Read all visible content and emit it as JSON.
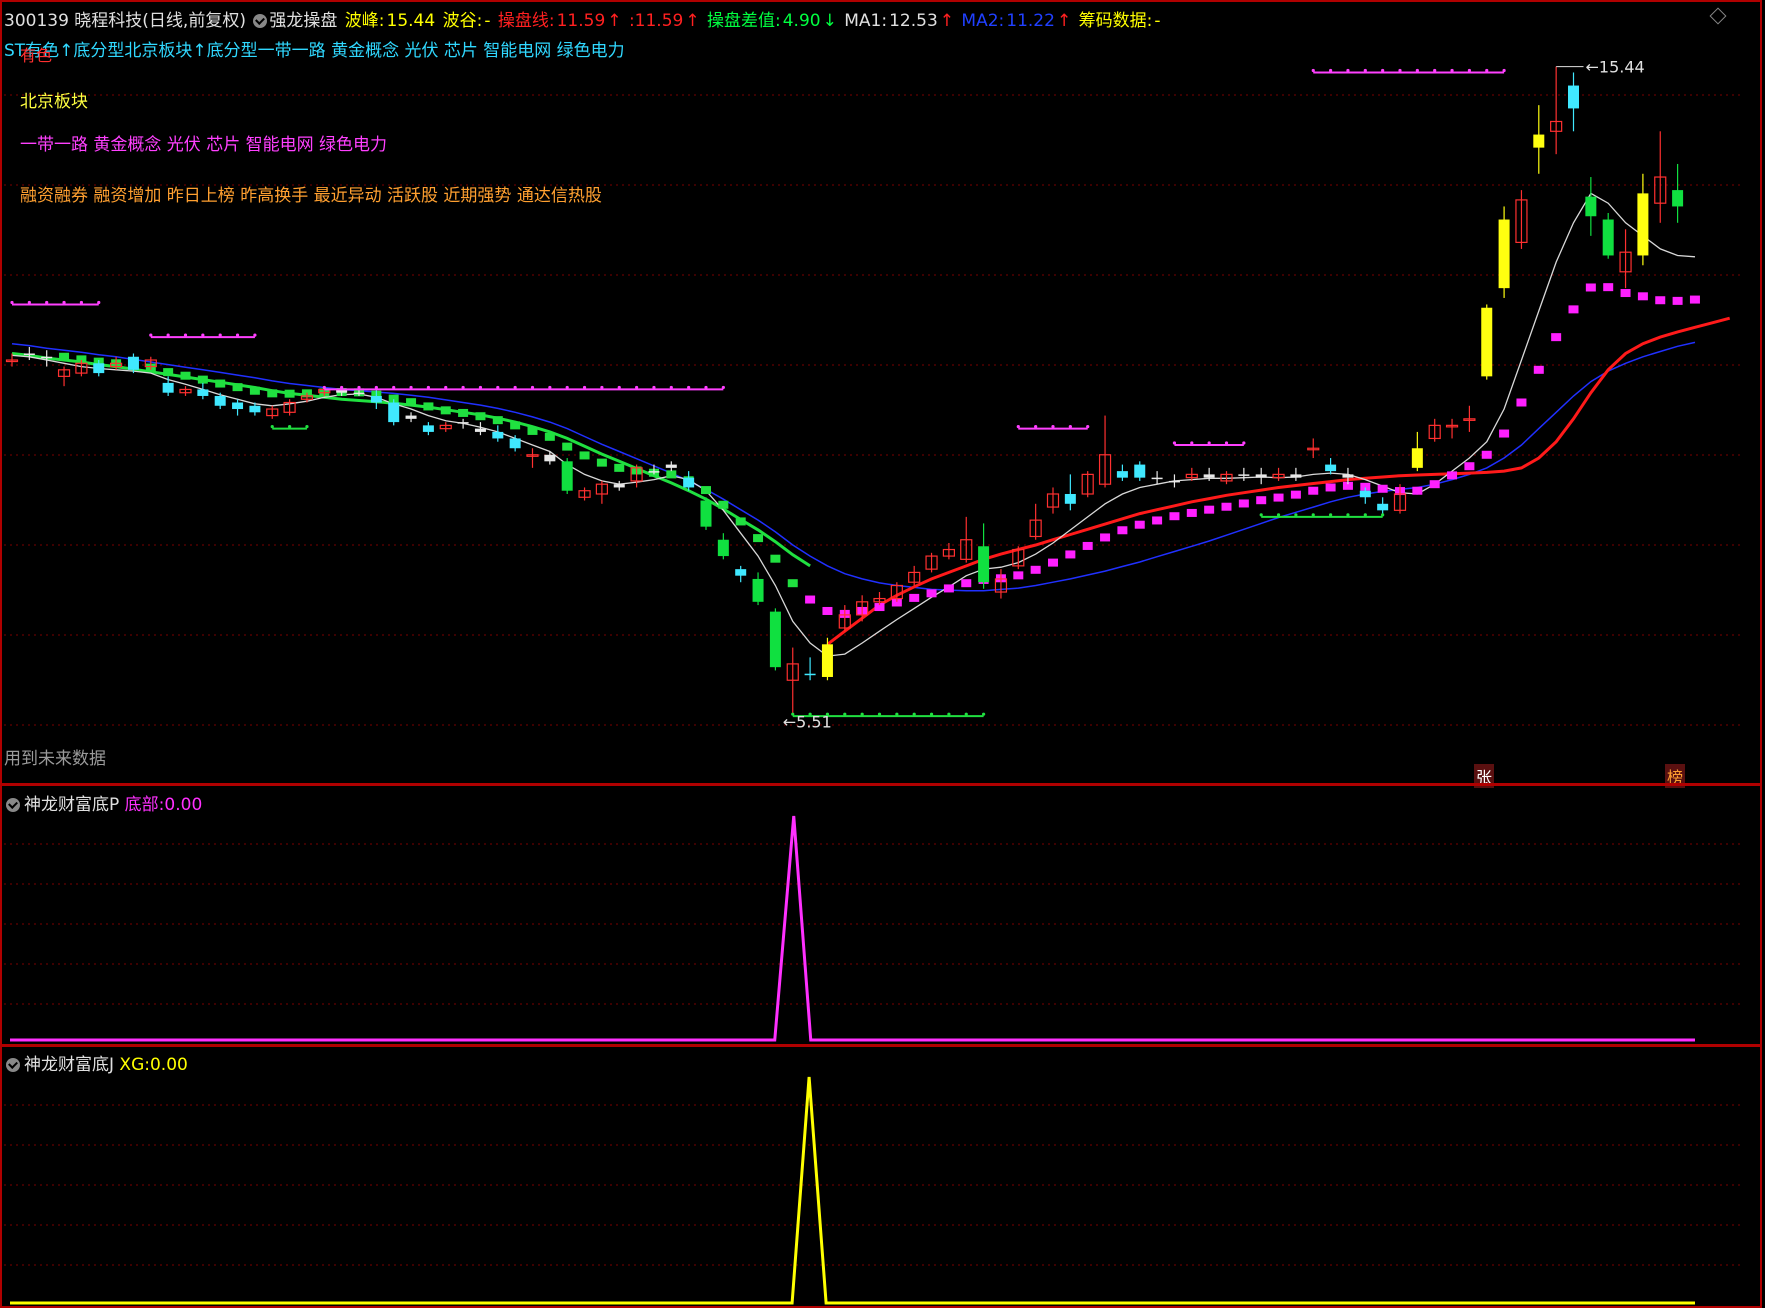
{
  "header": {
    "symbol_title": "300139 晓程科技(日线,前复权)",
    "indicator_name": "强龙操盘",
    "peak_label": "波峰:",
    "peak_value": "15.44",
    "trough_label": "波谷:",
    "trough_value": "-",
    "line_label": "操盘线:",
    "line_value": "11.59",
    "line_value2": ":11.59",
    "diff_label": "操盘差值:",
    "diff_value": "4.90",
    "ma1_label": "MA1:",
    "ma1_value": "12.53",
    "ma2_label": "MA2:",
    "ma2_value": "11.22",
    "chip_label": "筹码数据:",
    "chip_value": "-",
    "colors": {
      "peak": "#ffff00",
      "line": "#ff2020",
      "diff": "#00ff40",
      "ma1": "#e0e0e0",
      "ma2": "#2040ff",
      "chip": "#ffff00"
    }
  },
  "concepts": {
    "line1": "ST有色↑底分型北京板块↑底分型一带一路 黄金概念 光伏 芯片 智能电网 绿色电力",
    "line1_overlay": "有色",
    "line2": "北京板块",
    "line3": "一带一路 黄金概念 光伏 芯片 智能电网 绿色电力",
    "line4": "融资融券 融资增加 昨日上榜 昨高换手 最近异动 活跃股 近期强势 通达信热股"
  },
  "footer_note": "用到未来数据",
  "markers": {
    "zhang": "张",
    "bang": "榜",
    "high_label": "15.44",
    "low_label": "5.51"
  },
  "panel2": {
    "name": "神龙财富底P",
    "field_label": "底部:",
    "field_value": "0.00",
    "color": "#ff30ff"
  },
  "panel3": {
    "name": "神龙财富底J",
    "field_label": "XG:",
    "field_value": "0.00",
    "color": "#ffff00"
  },
  "chart_data": [
    {
      "type": "candlestick",
      "title": "300139 晓程科技(日线,前复权)",
      "ylim": [
        4.6,
        16.0
      ],
      "candles": [
        {
          "o": 10.95,
          "c": 10.95,
          "h": 11.05,
          "l": 10.85,
          "col": "red"
        },
        {
          "o": 11.05,
          "c": 11.05,
          "h": 11.15,
          "l": 10.95,
          "col": "white"
        },
        {
          "o": 11.0,
          "c": 11.0,
          "h": 11.1,
          "l": 10.85,
          "col": "white"
        },
        {
          "o": 10.7,
          "c": 10.8,
          "h": 10.85,
          "l": 10.55,
          "col": "red"
        },
        {
          "o": 10.75,
          "c": 10.9,
          "h": 10.95,
          "l": 10.7,
          "col": "red"
        },
        {
          "o": 10.9,
          "c": 10.75,
          "h": 10.95,
          "l": 10.7,
          "col": "cyan"
        },
        {
          "o": 10.85,
          "c": 10.9,
          "h": 11.0,
          "l": 10.8,
          "col": "red"
        },
        {
          "o": 11.0,
          "c": 10.8,
          "h": 11.05,
          "l": 10.75,
          "col": "cyan"
        },
        {
          "o": 10.85,
          "c": 10.95,
          "h": 11.0,
          "l": 10.8,
          "col": "red"
        },
        {
          "o": 10.6,
          "c": 10.45,
          "h": 10.7,
          "l": 10.4,
          "col": "cyan"
        },
        {
          "o": 10.45,
          "c": 10.5,
          "h": 10.55,
          "l": 10.4,
          "col": "red"
        },
        {
          "o": 10.5,
          "c": 10.4,
          "h": 10.6,
          "l": 10.35,
          "col": "cyan"
        },
        {
          "o": 10.4,
          "c": 10.25,
          "h": 10.45,
          "l": 10.2,
          "col": "cyan"
        },
        {
          "o": 10.3,
          "c": 10.2,
          "h": 10.35,
          "l": 10.1,
          "col": "cyan"
        },
        {
          "o": 10.25,
          "c": 10.15,
          "h": 10.3,
          "l": 10.1,
          "col": "cyan"
        },
        {
          "o": 10.1,
          "c": 10.2,
          "h": 10.25,
          "l": 10.05,
          "col": "red"
        },
        {
          "o": 10.15,
          "c": 10.3,
          "h": 10.35,
          "l": 10.1,
          "col": "red"
        },
        {
          "o": 10.35,
          "c": 10.4,
          "h": 10.45,
          "l": 10.3,
          "col": "red"
        },
        {
          "o": 10.45,
          "c": 10.5,
          "h": 10.55,
          "l": 10.4,
          "col": "red"
        },
        {
          "o": 10.5,
          "c": 10.45,
          "h": 10.55,
          "l": 10.4,
          "col": "white"
        },
        {
          "o": 10.45,
          "c": 10.45,
          "h": 10.5,
          "l": 10.4,
          "col": "white"
        },
        {
          "o": 10.4,
          "c": 10.3,
          "h": 10.5,
          "l": 10.2,
          "col": "cyan"
        },
        {
          "o": 10.3,
          "c": 10.0,
          "h": 10.35,
          "l": 9.95,
          "col": "cyan"
        },
        {
          "o": 10.1,
          "c": 10.05,
          "h": 10.15,
          "l": 10.0,
          "col": "white"
        },
        {
          "o": 9.95,
          "c": 9.85,
          "h": 10.0,
          "l": 9.8,
          "col": "cyan"
        },
        {
          "o": 9.9,
          "c": 9.95,
          "h": 10.0,
          "l": 9.85,
          "col": "red"
        },
        {
          "o": 10.0,
          "c": 10.0,
          "h": 10.05,
          "l": 9.9,
          "col": "white"
        },
        {
          "o": 9.9,
          "c": 9.85,
          "h": 10.0,
          "l": 9.8,
          "col": "white"
        },
        {
          "o": 9.85,
          "c": 9.75,
          "h": 9.95,
          "l": 9.7,
          "col": "cyan"
        },
        {
          "o": 9.75,
          "c": 9.6,
          "h": 9.8,
          "l": 9.55,
          "col": "cyan"
        },
        {
          "o": 9.5,
          "c": 9.5,
          "h": 9.6,
          "l": 9.3,
          "col": "red"
        },
        {
          "o": 9.5,
          "c": 9.4,
          "h": 9.55,
          "l": 9.35,
          "col": "white"
        },
        {
          "o": 9.4,
          "c": 8.95,
          "h": 9.45,
          "l": 8.9,
          "col": "green"
        },
        {
          "o": 8.85,
          "c": 8.95,
          "h": 9.0,
          "l": 8.8,
          "col": "red"
        },
        {
          "o": 8.9,
          "c": 9.05,
          "h": 9.1,
          "l": 8.75,
          "col": "red"
        },
        {
          "o": 9.05,
          "c": 9.0,
          "h": 9.1,
          "l": 8.95,
          "col": "white"
        },
        {
          "o": 9.1,
          "c": 9.3,
          "h": 9.35,
          "l": 9.0,
          "col": "red"
        },
        {
          "o": 9.25,
          "c": 9.25,
          "h": 9.35,
          "l": 9.2,
          "col": "white"
        },
        {
          "o": 9.3,
          "c": 9.35,
          "h": 9.4,
          "l": 9.25,
          "col": "white"
        },
        {
          "o": 9.15,
          "c": 9.0,
          "h": 9.25,
          "l": 8.95,
          "col": "cyan"
        },
        {
          "o": 8.8,
          "c": 8.4,
          "h": 8.85,
          "l": 8.35,
          "col": "green"
        },
        {
          "o": 8.2,
          "c": 7.95,
          "h": 8.3,
          "l": 7.9,
          "col": "green"
        },
        {
          "o": 7.75,
          "c": 7.65,
          "h": 7.8,
          "l": 7.55,
          "col": "cyan"
        },
        {
          "o": 7.6,
          "c": 7.25,
          "h": 7.7,
          "l": 7.2,
          "col": "green"
        },
        {
          "o": 7.1,
          "c": 6.25,
          "h": 7.15,
          "l": 6.2,
          "col": "green"
        },
        {
          "o": 6.05,
          "c": 6.3,
          "h": 6.55,
          "l": 5.51,
          "col": "red"
        },
        {
          "o": 6.15,
          "c": 6.15,
          "h": 6.4,
          "l": 6.05,
          "col": "cyan"
        },
        {
          "o": 6.1,
          "c": 6.6,
          "h": 6.7,
          "l": 6.05,
          "col": "yellow"
        },
        {
          "o": 6.85,
          "c": 7.05,
          "h": 7.2,
          "l": 6.8,
          "col": "red"
        },
        {
          "o": 7.05,
          "c": 7.25,
          "h": 7.35,
          "l": 6.95,
          "col": "red"
        },
        {
          "o": 7.25,
          "c": 7.3,
          "h": 7.4,
          "l": 7.2,
          "col": "red"
        },
        {
          "o": 7.3,
          "c": 7.5,
          "h": 7.55,
          "l": 7.25,
          "col": "red"
        },
        {
          "o": 7.55,
          "c": 7.7,
          "h": 7.8,
          "l": 7.5,
          "col": "red"
        },
        {
          "o": 7.75,
          "c": 7.95,
          "h": 8.0,
          "l": 7.7,
          "col": "red"
        },
        {
          "o": 7.95,
          "c": 8.05,
          "h": 8.15,
          "l": 7.9,
          "col": "red"
        },
        {
          "o": 7.9,
          "c": 8.2,
          "h": 8.55,
          "l": 7.85,
          "col": "red"
        },
        {
          "o": 8.1,
          "c": 7.55,
          "h": 8.45,
          "l": 7.45,
          "col": "green"
        },
        {
          "o": 7.4,
          "c": 7.6,
          "h": 7.75,
          "l": 7.3,
          "col": "red"
        },
        {
          "o": 7.8,
          "c": 8.05,
          "h": 8.1,
          "l": 7.75,
          "col": "red"
        },
        {
          "o": 8.25,
          "c": 8.5,
          "h": 8.75,
          "l": 8.2,
          "col": "red"
        },
        {
          "o": 8.7,
          "c": 8.9,
          "h": 9.0,
          "l": 8.6,
          "col": "red"
        },
        {
          "o": 8.9,
          "c": 8.75,
          "h": 9.2,
          "l": 8.65,
          "col": "cyan"
        },
        {
          "o": 8.9,
          "c": 9.2,
          "h": 9.25,
          "l": 8.85,
          "col": "red"
        },
        {
          "o": 9.05,
          "c": 9.5,
          "h": 10.1,
          "l": 9.0,
          "col": "red"
        },
        {
          "o": 9.25,
          "c": 9.15,
          "h": 9.35,
          "l": 9.1,
          "col": "cyan"
        },
        {
          "o": 9.35,
          "c": 9.15,
          "h": 9.4,
          "l": 9.1,
          "col": "cyan"
        },
        {
          "o": 9.15,
          "c": 9.15,
          "h": 9.25,
          "l": 9.05,
          "col": "white"
        },
        {
          "o": 9.1,
          "c": 9.1,
          "h": 9.2,
          "l": 9.0,
          "col": "white"
        },
        {
          "o": 9.15,
          "c": 9.2,
          "h": 9.3,
          "l": 9.1,
          "col": "red"
        },
        {
          "o": 9.2,
          "c": 9.15,
          "h": 9.3,
          "l": 9.1,
          "col": "white"
        },
        {
          "o": 9.1,
          "c": 9.2,
          "h": 9.25,
          "l": 9.05,
          "col": "red"
        },
        {
          "o": 9.2,
          "c": 9.2,
          "h": 9.3,
          "l": 9.1,
          "col": "white"
        },
        {
          "o": 9.2,
          "c": 9.15,
          "h": 9.3,
          "l": 9.05,
          "col": "white"
        },
        {
          "o": 9.15,
          "c": 9.2,
          "h": 9.3,
          "l": 9.1,
          "col": "red"
        },
        {
          "o": 9.2,
          "c": 9.15,
          "h": 9.3,
          "l": 9.1,
          "col": "white"
        },
        {
          "o": 9.6,
          "c": 9.6,
          "h": 9.75,
          "l": 9.45,
          "col": "red"
        },
        {
          "o": 9.35,
          "c": 9.25,
          "h": 9.45,
          "l": 9.2,
          "col": "cyan"
        },
        {
          "o": 9.2,
          "c": 9.15,
          "h": 9.3,
          "l": 9.05,
          "col": "white"
        },
        {
          "o": 8.95,
          "c": 8.85,
          "h": 9.0,
          "l": 8.75,
          "col": "cyan"
        },
        {
          "o": 8.75,
          "c": 8.65,
          "h": 8.85,
          "l": 8.6,
          "col": "cyan"
        },
        {
          "o": 8.65,
          "c": 8.9,
          "h": 9.05,
          "l": 8.6,
          "col": "red"
        },
        {
          "o": 9.3,
          "c": 9.6,
          "h": 9.85,
          "l": 9.25,
          "col": "yellow"
        },
        {
          "o": 9.75,
          "c": 9.95,
          "h": 10.05,
          "l": 9.7,
          "col": "red"
        },
        {
          "o": 9.95,
          "c": 9.95,
          "h": 10.05,
          "l": 9.75,
          "col": "red"
        },
        {
          "o": 10.05,
          "c": 10.05,
          "h": 10.25,
          "l": 9.85,
          "col": "red"
        },
        {
          "o": 10.7,
          "c": 11.75,
          "h": 11.8,
          "l": 10.65,
          "col": "yellow"
        },
        {
          "o": 12.05,
          "c": 13.1,
          "h": 13.3,
          "l": 11.9,
          "col": "yellow"
        },
        {
          "o": 12.75,
          "c": 13.4,
          "h": 13.55,
          "l": 12.65,
          "col": "red"
        },
        {
          "o": 14.2,
          "c": 14.4,
          "h": 14.85,
          "l": 13.8,
          "col": "yellow"
        },
        {
          "o": 14.45,
          "c": 14.6,
          "h": 15.44,
          "l": 14.1,
          "col": "red"
        },
        {
          "o": 15.15,
          "c": 14.8,
          "h": 15.35,
          "l": 14.45,
          "col": "cyan"
        },
        {
          "o": 13.45,
          "c": 13.15,
          "h": 13.75,
          "l": 12.85,
          "col": "green"
        },
        {
          "o": 13.1,
          "c": 12.55,
          "h": 13.2,
          "l": 12.5,
          "col": "green"
        },
        {
          "o": 12.3,
          "c": 12.6,
          "h": 12.95,
          "l": 12.05,
          "col": "red"
        },
        {
          "o": 12.55,
          "c": 13.5,
          "h": 13.8,
          "l": 12.4,
          "col": "yellow"
        },
        {
          "o": 13.35,
          "c": 13.75,
          "h": 14.45,
          "l": 13.05,
          "col": "red"
        },
        {
          "o": 13.3,
          "c": 13.55,
          "h": 13.95,
          "l": 13.05,
          "col": "green"
        }
      ],
      "ma1": [
        11.02,
        11.0,
        10.95,
        10.9,
        10.85,
        10.82,
        10.8,
        10.78,
        10.75,
        10.65,
        10.58,
        10.5,
        10.42,
        10.35,
        10.28,
        10.25,
        10.28,
        10.32,
        10.38,
        10.42,
        10.43,
        10.38,
        10.28,
        10.2,
        10.1,
        10.02,
        9.98,
        9.92,
        9.85,
        9.75,
        9.65,
        9.55,
        9.35,
        9.2,
        9.1,
        9.05,
        9.08,
        9.12,
        9.18,
        9.12,
        8.95,
        8.65,
        8.3,
        7.95,
        7.5,
        6.95,
        6.62,
        6.42,
        6.45,
        6.62,
        6.8,
        6.98,
        7.15,
        7.32,
        7.48,
        7.65,
        7.75,
        7.78,
        7.85,
        7.98,
        8.15,
        8.35,
        8.55,
        8.75,
        8.9,
        9.0,
        9.05,
        9.1,
        9.12,
        9.14,
        9.14,
        9.15,
        9.16,
        9.15,
        9.16,
        9.2,
        9.22,
        9.2,
        9.12,
        9.02,
        8.92,
        8.9,
        9.05,
        9.25,
        9.45,
        9.7,
        10.2,
        10.95,
        11.7,
        12.45,
        13.05,
        13.5,
        13.35,
        13.05,
        12.85,
        12.65,
        12.55,
        12.53
      ],
      "ma2": [
        11.2,
        11.17,
        11.13,
        11.1,
        11.07,
        11.03,
        11.0,
        10.96,
        10.92,
        10.88,
        10.84,
        10.8,
        10.76,
        10.72,
        10.68,
        10.63,
        10.59,
        10.56,
        10.53,
        10.5,
        10.48,
        10.46,
        10.44,
        10.41,
        10.38,
        10.34,
        10.3,
        10.26,
        10.21,
        10.15,
        10.08,
        10.0,
        9.9,
        9.78,
        9.66,
        9.55,
        9.44,
        9.33,
        9.22,
        9.1,
        8.97,
        8.82,
        8.66,
        8.5,
        8.32,
        8.12,
        7.95,
        7.8,
        7.68,
        7.6,
        7.54,
        7.5,
        7.47,
        7.44,
        7.43,
        7.42,
        7.42,
        7.44,
        7.46,
        7.5,
        7.55,
        7.6,
        7.66,
        7.72,
        7.79,
        7.86,
        7.94,
        8.02,
        8.1,
        8.18,
        8.27,
        8.36,
        8.45,
        8.54,
        8.62,
        8.7,
        8.78,
        8.85,
        8.9,
        8.94,
        8.97,
        9.0,
        9.05,
        9.12,
        9.2,
        9.3,
        9.45,
        9.65,
        9.9,
        10.15,
        10.4,
        10.62,
        10.78,
        10.9,
        11.0,
        11.08,
        11.16,
        11.22
      ],
      "line_red": {
        "start_index": 47,
        "values": [
          6.6,
          6.8,
          7.0,
          7.2,
          7.35,
          7.48,
          7.6,
          7.7,
          7.8,
          7.9,
          7.98,
          8.05,
          8.12,
          8.2,
          8.28,
          8.36,
          8.44,
          8.52,
          8.6,
          8.66,
          8.72,
          8.78,
          8.83,
          8.88,
          8.92,
          8.96,
          9.0,
          9.03,
          9.06,
          9.09,
          9.12,
          9.14,
          9.16,
          9.18,
          9.19,
          9.2,
          9.21,
          9.22,
          9.23,
          9.25,
          9.3,
          9.45,
          9.7,
          10.05,
          10.45,
          10.8,
          11.05,
          11.2,
          11.3,
          11.38,
          11.45,
          11.52,
          11.59
        ]
      },
      "line_green_start_count": 47
    },
    {
      "type": "line",
      "name": "神龙财富底P 底部",
      "values": "0 everywhere except a single spike to 1 at candle index 45",
      "spike_index": 45,
      "ylim": [
        0,
        1.05
      ]
    },
    {
      "type": "line",
      "name": "神龙财富底J XG",
      "values": "0 everywhere except a single spike to 1 at candle index 46",
      "spike_index": 46,
      "ylim": [
        0,
        1.05
      ]
    }
  ]
}
